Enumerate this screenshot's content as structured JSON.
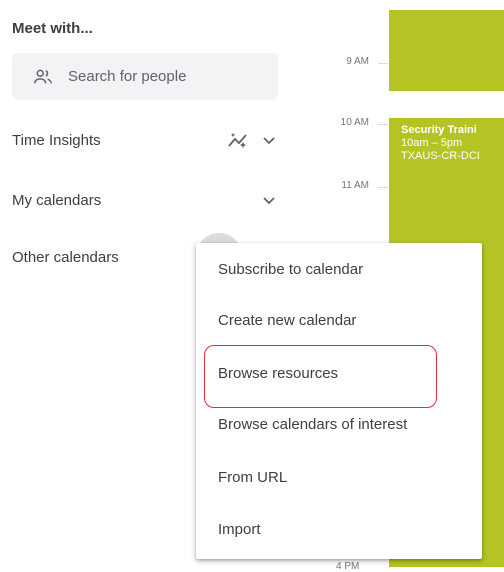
{
  "sidebar": {
    "meet_title": "Meet with...",
    "search_placeholder": "Search for people",
    "time_insights": "Time Insights",
    "my_calendars": "My calendars",
    "other_calendars": "Other calendars"
  },
  "timegrid": {
    "times": [
      "9 AM",
      "10 AM",
      "11 AM"
    ],
    "bottom_time": "4 PM"
  },
  "event": {
    "title": "Security Traini",
    "time": "10am – 5pm",
    "location": "TXAUS-CR-DCI",
    "color": "#b5c424"
  },
  "menu": {
    "items": [
      "Subscribe to calendar",
      "Create new calendar",
      "Browse resources",
      "Browse calendars of interest",
      "From URL",
      "Import"
    ],
    "highlighted_index": 2,
    "highlight_color": "#e0303a"
  }
}
